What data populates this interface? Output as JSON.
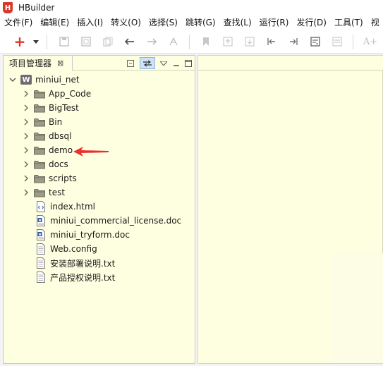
{
  "app": {
    "title": "HBuilder",
    "logo_letter": "H"
  },
  "menu": [
    "文件(F)",
    "编辑(E)",
    "插入(I)",
    "转义(O)",
    "选择(S)",
    "跳转(G)",
    "查找(L)",
    "运行(R)",
    "发行(D)",
    "工具(T)",
    "视"
  ],
  "toolbar": {
    "icons": [
      "new-icon",
      "dropdown-arrow-icon",
      "save-icon",
      "save-all-icon",
      "copy-icon",
      "undo-icon",
      "redo-icon",
      "format-icon",
      "bookmark-icon",
      "page-up-icon",
      "page-down-icon",
      "first-icon",
      "last-icon",
      "preview-icon",
      "doc-icon",
      "font-size-icon"
    ],
    "add_symbol": "+",
    "font_label": "A+"
  },
  "panel": {
    "tab_label": "项目管理器",
    "close_symbol": "⊠"
  },
  "tree": {
    "root": {
      "label": "miniui_net",
      "icon": "web-project-icon",
      "icon_letter": "W",
      "expanded": true
    },
    "folders": [
      "App_Code",
      "BigTest",
      "Bin",
      "dbsql",
      "demo",
      "docs",
      "scripts",
      "test"
    ],
    "files": [
      {
        "label": "index.html",
        "icon": "html-file-icon"
      },
      {
        "label": "miniui_commercial_license.doc",
        "icon": "doc-file-icon"
      },
      {
        "label": "miniui_tryform.doc",
        "icon": "doc-file-icon"
      },
      {
        "label": "Web.config",
        "icon": "text-file-icon"
      },
      {
        "label": "安装部署说明.txt",
        "icon": "text-file-icon"
      },
      {
        "label": "产品授权说明.txt",
        "icon": "text-file-icon"
      }
    ]
  },
  "colors": {
    "panel_bg": "#fefee1",
    "accent_red": "#d9392b",
    "arrow": "#e8322e",
    "folder": "#8a8a7a"
  }
}
